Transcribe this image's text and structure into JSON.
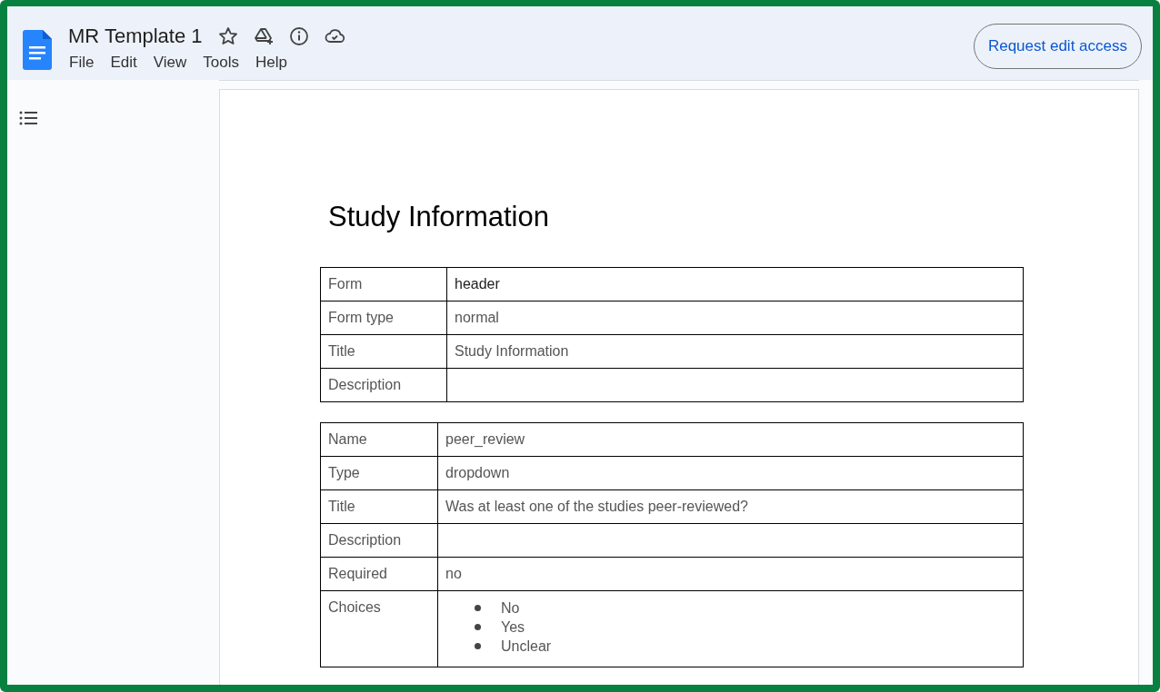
{
  "document": {
    "title": "MR Template 1",
    "menu": [
      "File",
      "Edit",
      "View",
      "Tools",
      "Help"
    ],
    "request_button": "Request edit access"
  },
  "page": {
    "heading": "Study Information",
    "tables": [
      {
        "rows": [
          {
            "kind": "text",
            "label": "Form",
            "value": "header"
          },
          {
            "kind": "text",
            "label": "Form type",
            "value": "normal"
          },
          {
            "kind": "text",
            "label": "Title",
            "value": "Study Information"
          },
          {
            "kind": "text",
            "label": "Description"
          }
        ]
      },
      {
        "rows": [
          {
            "kind": "text",
            "label": "Name",
            "value": "peer_review"
          },
          {
            "kind": "text",
            "label": "Type",
            "value": "dropdown"
          },
          {
            "kind": "text",
            "label": "Title",
            "value": "Was at least one of the studies peer-reviewed?"
          },
          {
            "kind": "text",
            "label": "Description"
          },
          {
            "kind": "text",
            "label": "Required",
            "value": "no"
          },
          {
            "kind": "list",
            "label": "Choices",
            "items": [
              "No",
              "Yes",
              "Unclear"
            ]
          }
        ]
      }
    ]
  }
}
